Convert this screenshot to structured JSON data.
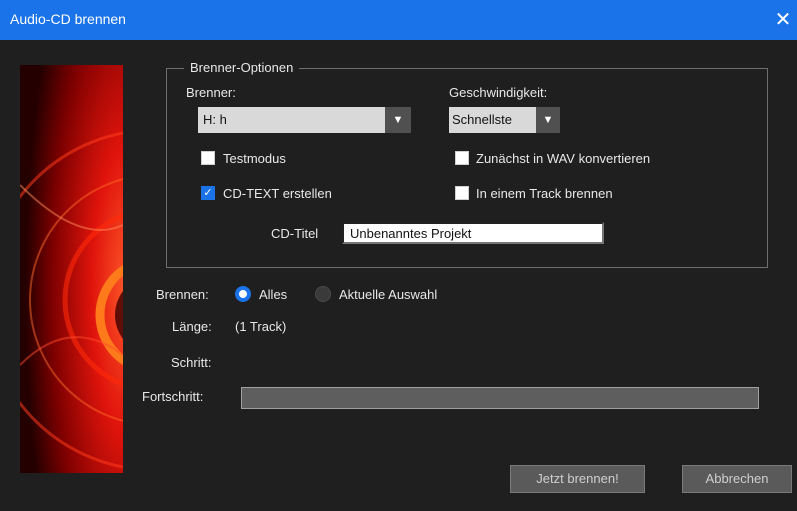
{
  "window": {
    "title": "Audio-CD brennen",
    "close_glyph": "✕"
  },
  "burner_options": {
    "legend": "Brenner-Optionen",
    "burner_label": "Brenner:",
    "burner_value": "H: h",
    "speed_label": "Geschwindigkeit:",
    "speed_value": "Schnellste",
    "checkboxes": {
      "testmodus": {
        "label": "Testmodus",
        "checked": false
      },
      "wav": {
        "label": "Zunächst in WAV konvertieren",
        "checked": false
      },
      "cdtext": {
        "label": "CD-TEXT erstellen",
        "checked": true
      },
      "onetrack": {
        "label": "In einem Track brennen",
        "checked": false
      }
    },
    "cd_title_label": "CD-Titel",
    "cd_title_value": "Unbenanntes Projekt"
  },
  "burn": {
    "label": "Brennen:",
    "options": [
      {
        "label": "Alles",
        "selected": true
      },
      {
        "label": "Aktuelle Auswahl",
        "selected": false
      }
    ]
  },
  "length": {
    "label": "Länge:",
    "value": "(1 Track)"
  },
  "step": {
    "label": "Schritt:"
  },
  "progress": {
    "label": "Fortschritt:",
    "fraction": 0
  },
  "buttons": {
    "burn_now": "Jetzt brennen!",
    "cancel": "Abbrechen"
  },
  "colors": {
    "accent": "#1a73e8",
    "background": "#1f1f1f"
  },
  "icons": {
    "dropdown": "chevron-down-icon",
    "close": "close-icon",
    "check": "checkmark-icon"
  }
}
